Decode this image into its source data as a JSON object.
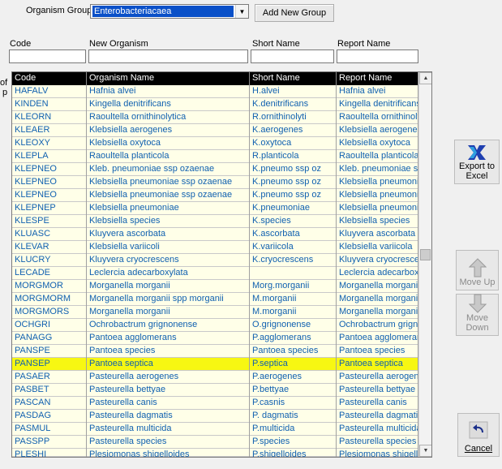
{
  "header": {
    "organism_group_label": "Organism Group",
    "organism_group_value": "Enterobacteriacaea",
    "add_new_group_label": "Add New Group"
  },
  "form": {
    "code_label": "Code",
    "new_organism_label": "New Organism",
    "short_name_label": "Short Name",
    "report_name_label": "Report Name",
    "left_clipped_label_1": "of",
    "left_clipped_label_2": "p"
  },
  "grid": {
    "columns": [
      "Code",
      "Organism Name",
      "Short Name",
      "Report Name"
    ],
    "highlighted_row": 21,
    "rows": [
      [
        "HAFALV",
        "Hafnia alvei",
        "H.alvei",
        "Hafnia alvei"
      ],
      [
        "KINDEN",
        "Kingella denitrificans",
        "K.denitrificans",
        "Kingella denitrificans"
      ],
      [
        "KLEORN",
        "Raoultella ornithinolytica",
        "R.ornithinolyti",
        "Raoultella ornithinoly"
      ],
      [
        "KLEAER",
        "Klebsiella aerogenes",
        "K.aerogenes",
        "Klebsiella aerogenes"
      ],
      [
        "KLEOXY",
        "Klebsiella oxytoca",
        "K.oxytoca",
        "Klebsiella oxytoca"
      ],
      [
        "KLEPLA",
        "Raoultella planticola",
        "R.planticola",
        "Raoultella planticola"
      ],
      [
        "KLEPNEO",
        "Kleb. pneumoniae ssp ozaenae",
        "K.pneumo ssp oz",
        "Kleb. pneumoniae ss"
      ],
      [
        "KLEPNEO",
        "Klebsiella pneumoniae ssp ozaenae",
        "K.pneumo ssp oz",
        "Klebsiella pneumonia"
      ],
      [
        "KLEPNEO",
        "Klebsiella pneumoniae ssp ozaenae",
        "K.pneumo ssp oz",
        "Klebsiella pneumonia"
      ],
      [
        "KLEPNEP",
        "Klebsiella pneumoniae",
        "K.pneumoniae",
        "Klebsiella pneumonia"
      ],
      [
        "KLESPE",
        "Klebsiella species",
        "K.species",
        "Klebsiella species"
      ],
      [
        "KLUASC",
        "Kluyvera ascorbata",
        "K.ascorbata",
        "Kluyvera ascorbata"
      ],
      [
        "KLEVAR",
        "Klebsiella variicoli",
        "K.variicola",
        "Klebsiella variicola"
      ],
      [
        "KLUCRY",
        "Kluyvera cryocrescens",
        "K.cryocrescens",
        "Kluyvera cryocresce"
      ],
      [
        "LECADE",
        "Leclercia adecarboxylata",
        "",
        "Leclercia adecarbox"
      ],
      [
        "MORGMOR",
        "Morganella morganii",
        "Morg.morganii",
        "Morganella morganii"
      ],
      [
        "MORGMORM",
        "Morganella morganii spp morganii",
        "M.morganii",
        "Morganella morganii"
      ],
      [
        "MORGMORS",
        "Morganella morganii",
        "M.morganii",
        "Morganella morganii"
      ],
      [
        "OCHGRI",
        "Ochrobactrum grignonense",
        "O.grignonense",
        "Ochrobactrum grigno"
      ],
      [
        "PANAGG",
        "Pantoea agglomerans",
        "P.agglomerans",
        "Pantoea agglomerar"
      ],
      [
        "PANSPE",
        "Pantoea species",
        "Pantoea species",
        "Pantoea species"
      ],
      [
        "PANSEP",
        "Pantoea septica",
        "P.septica",
        "Pantoea septica"
      ],
      [
        "PASAER",
        "Pasteurella aerogenes",
        "P.aerogenes",
        "Pasteurella aerogen"
      ],
      [
        "PASBET",
        "Pasteurella bettyae",
        "P.bettyae",
        "Pasteurella bettyae"
      ],
      [
        "PASCAN",
        "Pasteurella canis",
        "P.casnis",
        "Pasteurella canis"
      ],
      [
        "PASDAG",
        "Pasteurella dagmatis",
        "P. dagmatis",
        "Pasteurella dagmatis"
      ],
      [
        "PASMUL",
        "Pasteurella multicida",
        "P.multicida",
        "Pasteurella multicida"
      ],
      [
        "PASSPP",
        "Pasteurella species",
        "P.species",
        "Pasteurella species"
      ],
      [
        "PLESHI",
        "Plesiomonas shigelloides",
        "P.shigelloides",
        "Plesiomonas shigello"
      ]
    ]
  },
  "actions": {
    "export_label": "Export to Excel",
    "move_up_label": "Move Up",
    "move_down_label": "Move Down",
    "cancel_label": "Cancel"
  }
}
